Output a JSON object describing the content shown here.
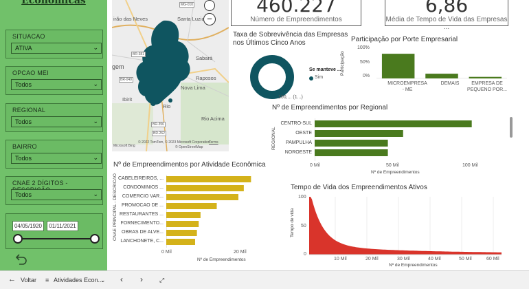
{
  "left_panel": {
    "title": "Econômicas",
    "filters": [
      {
        "label": "SITUACAO",
        "value": "ATIVA"
      },
      {
        "label": "OPCAO MEI",
        "value": "Todos"
      },
      {
        "label": "REGIONAL",
        "value": "Todos"
      },
      {
        "label": "BAIRRO",
        "value": "Todos"
      },
      {
        "label": "CNAE 2 DÍGITOS - DESCRIÇÃO",
        "value": "Todos"
      }
    ],
    "date_range": {
      "start": "04/05/1920",
      "end": "01/11/2021"
    }
  },
  "map": {
    "labels": [
      "irão das Neves",
      "Santa Luzia",
      "gem",
      "Sabará",
      "Raposos",
      "Nova Lima",
      "Ibirit",
      "Rio Acima",
      "MG-010",
      "BR-381",
      "BR-040",
      "BR-356",
      "BR-262",
      "Rio"
    ],
    "copyright": "© 2022 TomTom, © 2023 Microsoft Corporation",
    "terms": "Terms",
    "osm": "© OpenStreetMap",
    "bing": "Microsoft Bing"
  },
  "kpis": [
    {
      "value": "460.227",
      "label": "Número de Empreendimentos"
    },
    {
      "value": "6,86",
      "label": "Média de Tempo de Vida das Empresas ..."
    }
  ],
  "survival": {
    "title_line1": "Taxa de Sobrevivência das Empresas",
    "title_line2": "nos Últimos Cinco Anos",
    "legend_title": "Se manteve ...",
    "legend_item": "Sim",
    "data_label": "100,... (1...)",
    "color": "#0f5560"
  },
  "porte": {
    "title": "Participação por Porte Empresarial",
    "ylabel": "Participação",
    "yticks": [
      "100%",
      "50%",
      "0%"
    ],
    "categories": [
      "MICROEMPRESA - ME",
      "DEMAIS",
      "EMPRESA DE PEQUENO POR..."
    ],
    "cat_line1": [
      "MICROEMPRESA",
      "DEMAIS",
      "EMPRESA DE"
    ],
    "cat_line2": [
      "- ME",
      "",
      "PEQUENO POR..."
    ],
    "values": [
      0.78,
      0.15,
      0.05
    ],
    "color": "#4a7a1e"
  },
  "regional": {
    "title": "Nº de Empreendimentos por Regional",
    "ylabel": "REGIONAL",
    "xlabel": "Nº de Empreendimentos",
    "categories": [
      "CENTRO-SUL",
      "OESTE",
      "PAMPULHA",
      "NOROESTE"
    ],
    "values": [
      103000,
      58000,
      48000,
      48000
    ],
    "xticks": [
      "0 Mil",
      "50 Mil",
      "100 Mil"
    ],
    "color": "#4a7a1e"
  },
  "atividade": {
    "title": "Nº de Empreendimentos por Atividade Econômica",
    "ylabel": "CNAE PRINCIPAL - DESCRICAO",
    "xlabel": "Nº de Empreendimentos",
    "categories": [
      "CABELEIREIROS, ...",
      "CONDOMINIOS ...",
      "COMERCIO VAR...",
      "PROMOCAO DE ...",
      "RESTAURANTES ...",
      "FORNECIMENTO...",
      "OBRAS DE ALVE...",
      "LANCHONETE, C..."
    ],
    "values": [
      23500,
      21500,
      20000,
      14000,
      9500,
      9000,
      8500,
      8000
    ],
    "xticks": [
      "0 Mil",
      "20 Mil"
    ],
    "color": "#d4b21a"
  },
  "vida": {
    "title": "Tempo de Vida dos Empreendimentos Ativos",
    "ylabel": "Tempo de vida",
    "xlabel": "Nº de Empreendimentos",
    "yticks": [
      "100",
      "50",
      "0"
    ],
    "xticks": [
      "10 Mil",
      "20 Mil",
      "30 Mil",
      "40 Mil",
      "50 Mil",
      "60 Mil"
    ],
    "color": "#d9342b"
  },
  "bottom_bar": {
    "back_label": "Voltar",
    "page_label": "Atividades Econ..."
  }
}
